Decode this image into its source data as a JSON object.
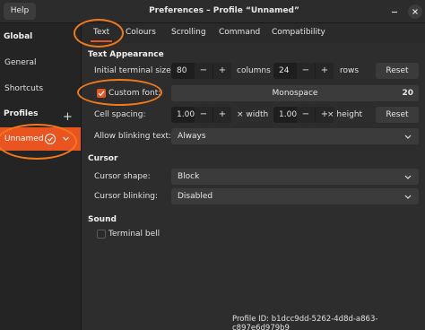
{
  "titlebar": {
    "help_label": "Help",
    "title": "Preferences – Profile “Unnamed”"
  },
  "sidebar": {
    "global_heading": "Global",
    "items": [
      {
        "label": "General"
      },
      {
        "label": "Shortcuts"
      }
    ],
    "profiles_heading": "Profiles",
    "add_icon": "+",
    "profiles": [
      {
        "label": "Unnamed",
        "selected": true
      }
    ]
  },
  "tabs": [
    {
      "label": "Text",
      "active": true
    },
    {
      "label": "Colours"
    },
    {
      "label": "Scrolling"
    },
    {
      "label": "Command"
    },
    {
      "label": "Compatibility"
    }
  ],
  "text_appearance": {
    "heading": "Text Appearance",
    "initial_size_label": "Initial terminal size:",
    "columns_value": "80",
    "columns_label": "columns",
    "rows_value": "24",
    "rows_label": "rows",
    "reset_label": "Reset",
    "custom_font_label": "Custom font:",
    "custom_font_checked": true,
    "font_name": "Monospace",
    "font_size": "20",
    "cell_spacing_label": "Cell spacing:",
    "width_value": "1.00",
    "width_label": "× width",
    "height_value": "1.00",
    "height_label": "× height",
    "cell_reset_label": "Reset",
    "blinking_text_label": "Allow blinking text:",
    "blinking_text_value": "Always"
  },
  "cursor": {
    "heading": "Cursor",
    "shape_label": "Cursor shape:",
    "shape_value": "Block",
    "blinking_label": "Cursor blinking:",
    "blinking_value": "Disabled"
  },
  "sound": {
    "heading": "Sound",
    "terminal_bell_label": "Terminal bell",
    "terminal_bell_checked": false
  },
  "footer": {
    "profile_id": "Profile ID:  b1dcc9dd-5262-4d8d-a863-c897e6d979b9"
  },
  "stepper": {
    "minus": "−",
    "plus": "+"
  },
  "colors": {
    "accent": "#e95420",
    "annotation": "#f07a1a"
  },
  "icons": [
    "minimize-icon",
    "close-icon",
    "add-icon",
    "check-circle-icon",
    "chevron-down-icon",
    "checkmark-icon"
  ]
}
